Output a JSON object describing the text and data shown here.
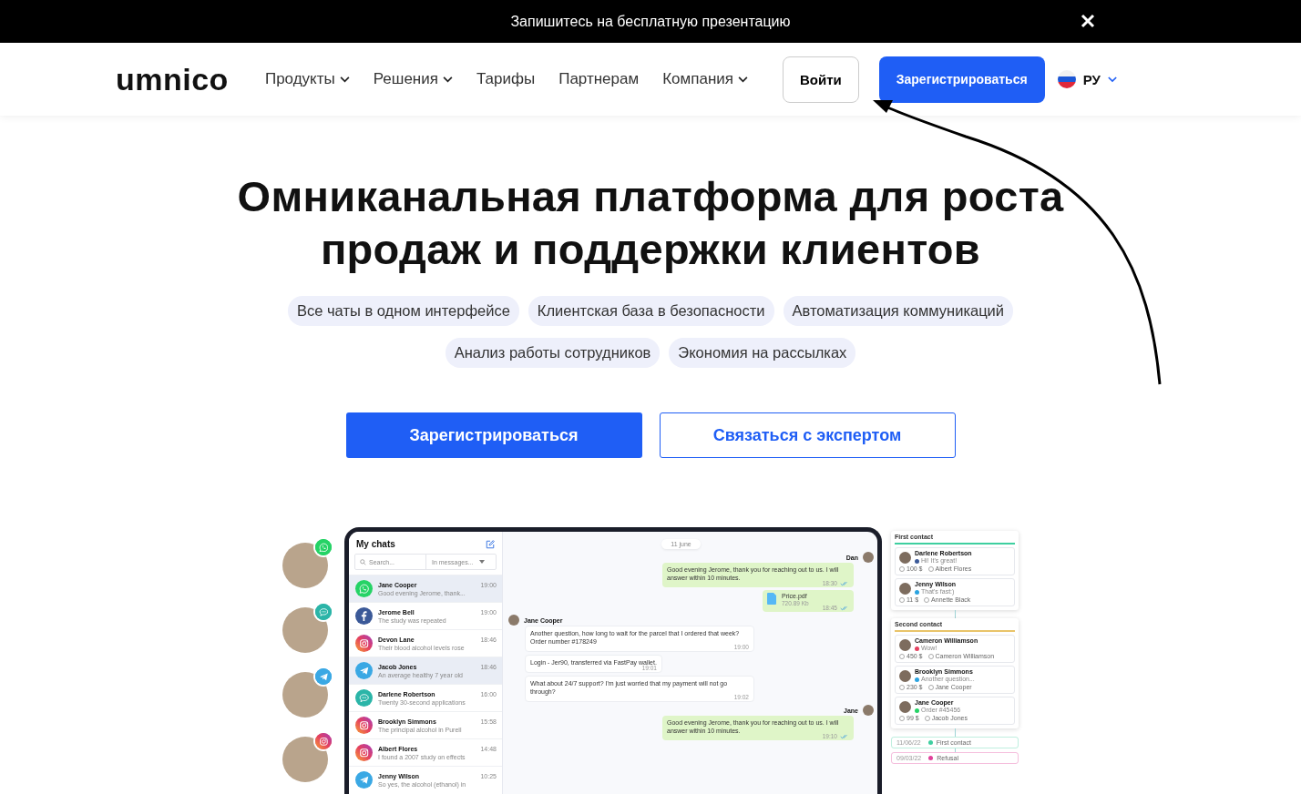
{
  "banner": {
    "text": "Запишитесь на бесплатную презентацию"
  },
  "header": {
    "logo": "umnico",
    "nav": [
      {
        "label": "Продукты",
        "dropdown": true
      },
      {
        "label": "Решения",
        "dropdown": true
      },
      {
        "label": "Тарифы",
        "dropdown": false
      },
      {
        "label": "Партнерам",
        "dropdown": false
      },
      {
        "label": "Компания",
        "dropdown": true
      }
    ],
    "login": "Войти",
    "register": "Зарегистрироваться",
    "language": "РУ"
  },
  "hero": {
    "title_lines": [
      "Омниканальная платформа для роста",
      "продаж и поддержки клиентов"
    ],
    "feature_rows": [
      [
        "Все чаты в одном интерфейсе",
        "Клиентская база в безопасности",
        "Автоматизация коммуникаций"
      ],
      [
        "Анализ работы сотрудников",
        "Экономия на рассылках"
      ]
    ],
    "primary_button": "Зарегистрироваться",
    "secondary_button": "Связаться с экспертом"
  },
  "contact_avatars": [
    {
      "kind": "whatsapp"
    },
    {
      "kind": "chat"
    },
    {
      "kind": "telegram"
    },
    {
      "kind": "instagram"
    }
  ],
  "chats": {
    "title": "My chats",
    "search": {
      "placeholder": "Search..."
    },
    "filter": "In messages...",
    "items": [
      {
        "kind": "whatsapp",
        "name": "Jane Cooper",
        "preview": "Good evening Jerome, thank...",
        "time": "19:00",
        "selected": true
      },
      {
        "kind": "facebook",
        "name": "Jerome Bell",
        "preview": "The study was repeated",
        "time": "19:00",
        "selected": false
      },
      {
        "kind": "instagram",
        "name": "Devon Lane",
        "preview": "Their blood alcohol levels rose",
        "time": "18:46",
        "selected": false
      },
      {
        "kind": "telegram",
        "name": "Jacob Jones",
        "preview": "An average healthy 7 year old",
        "time": "18:46",
        "selected": true
      },
      {
        "kind": "chat",
        "name": "Darlene Robertson",
        "preview": "Twenty 30-second applications",
        "time": "16:00",
        "selected": false
      },
      {
        "kind": "instagram",
        "name": "Brooklyn Simmons",
        "preview": "The principal alcohol in Purell",
        "time": "15:58",
        "selected": false
      },
      {
        "kind": "instagram",
        "name": "Albert Flores",
        "preview": "I found a 2007 study on effects",
        "time": "14:48",
        "selected": false
      },
      {
        "kind": "telegram",
        "name": "Jenny Wilson",
        "preview": "So yes, the alcohol (ethanol) in",
        "time": "10:25",
        "selected": false
      }
    ]
  },
  "conversation": {
    "date": "11 june",
    "messages": [
      {
        "kind": "out",
        "author": "Dan",
        "text": "Good evening Jerome, thank you for reaching out to us. I will answer within 10 minutes.",
        "time": "18:30"
      },
      {
        "kind": "file",
        "file_name": "Price.pdf",
        "file_size": "720.89 Kb",
        "time": "18:45"
      },
      {
        "kind": "in",
        "author": "Jane Cooper",
        "text": "Another question, how long to wait for the parcel that I ordered that week? Order number #178249",
        "time": "19:00"
      },
      {
        "kind": "in",
        "text": "Login - Jer90, transferred via FastPay wallet.",
        "time": "19:01"
      },
      {
        "kind": "in",
        "text": "What about 24/7 support? I'm just worried that my payment will not go through?",
        "time": "19:02"
      },
      {
        "kind": "out",
        "author": "Jane",
        "text": "Good evening Jerome, thank you for reaching out to us. I will answer within 10 minutes.",
        "time": "19:10"
      }
    ]
  },
  "pipeline": {
    "stages": [
      {
        "title": "First contact",
        "color": "#3ecfa0",
        "cards": [
          {
            "name": "Darlene Robertson",
            "message": "Hi! It's great!",
            "color": "#3b5998",
            "amount": "100 $",
            "manager": "Albert Flores"
          },
          {
            "name": "Jenny Wilson",
            "message": "That's fast:)",
            "color": "#2aa3e0",
            "amount": "11 $",
            "manager": "Annette Black"
          }
        ]
      },
      {
        "title": "Second contact",
        "color": "#e9c46a",
        "cards": [
          {
            "name": "Cameron Williamson",
            "message": "Wow!",
            "color": "#e4405f",
            "amount": "450 $",
            "manager": "Cameron Williamson"
          },
          {
            "name": "Brooklyn Simmons",
            "message": "Another question...",
            "color": "#2aa3e0",
            "amount": "230 $",
            "manager": "Jane Cooper"
          },
          {
            "name": "Jane Cooper",
            "message": "Order #45456",
            "color": "#25d366",
            "amount": "99 $",
            "manager": "Jacob Jones"
          }
        ]
      }
    ],
    "history": [
      {
        "date": "11/06/22",
        "status": "First contact",
        "color": "#3ecfa0"
      },
      {
        "date": "09/03/22",
        "status": "Refusal",
        "color": "#e0409a"
      }
    ]
  }
}
